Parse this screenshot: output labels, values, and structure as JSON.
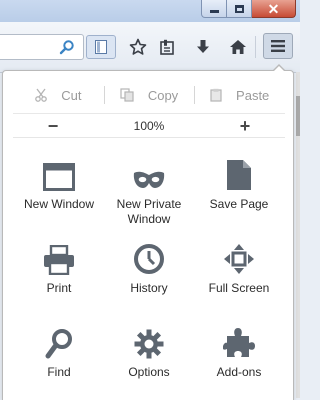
{
  "toolbar": {
    "icons": [
      "search-icon",
      "reader-view-icon",
      "bookmark-star-icon",
      "bookmarks-list-icon",
      "download-icon",
      "home-icon",
      "hamburger-menu-icon"
    ]
  },
  "window_controls": [
    "minimize",
    "maximize",
    "close"
  ],
  "menu": {
    "edit": {
      "cut": "Cut",
      "copy": "Copy",
      "paste": "Paste"
    },
    "zoom": {
      "out": "−",
      "level": "100%",
      "in": "+"
    },
    "items": [
      {
        "label": "New Window",
        "icon": "new-window-icon"
      },
      {
        "label": "New Private Window",
        "icon": "private-mask-icon"
      },
      {
        "label": "Save Page",
        "icon": "save-page-icon"
      },
      {
        "label": "Print",
        "icon": "printer-icon"
      },
      {
        "label": "History",
        "icon": "clock-icon"
      },
      {
        "label": "Full Screen",
        "icon": "fullscreen-icon"
      },
      {
        "label": "Find",
        "icon": "find-icon"
      },
      {
        "label": "Options",
        "icon": "gear-icon"
      },
      {
        "label": "Add-ons",
        "icon": "puzzle-icon"
      }
    ]
  },
  "colors": {
    "icon": "#5d6670",
    "disabled": "#a6a6a6",
    "panel": "#ffffff"
  }
}
